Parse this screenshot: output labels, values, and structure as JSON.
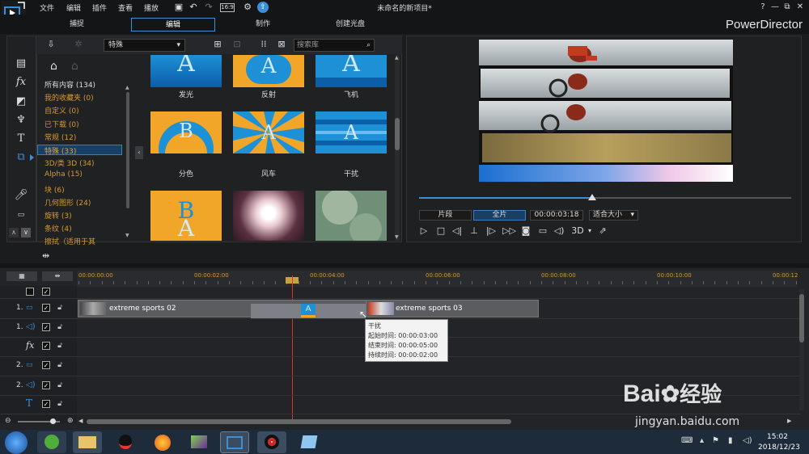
{
  "menu": [
    "文件",
    "编辑",
    "插件",
    "查看",
    "播放"
  ],
  "window_title": "未命名的新项目*",
  "brand": "PowerDirector",
  "window_controls": [
    "?",
    "—",
    "⧉",
    "✕"
  ],
  "modes": [
    "捕捉",
    "编辑",
    "制作",
    "创建光盘"
  ],
  "active_mode": "编辑",
  "library": {
    "category_select": "特殊",
    "search_placeholder": "搜索库",
    "categories": [
      {
        "label": "所有内容 (134)",
        "style": "white"
      },
      {
        "label": "我的收藏夹 (0)",
        "style": "orange"
      },
      {
        "label": "自定义 (0)",
        "style": "orange"
      },
      {
        "label": "已下载 (0)",
        "style": "orange"
      },
      {
        "label": "常规 (12)",
        "style": "orange"
      },
      {
        "label": "特殊 (33)",
        "style": "selected"
      },
      {
        "label": "3D/类 3D (34)",
        "style": "orange"
      },
      {
        "label": "Alpha (15)",
        "style": "orange"
      },
      {
        "label": "块 (6)",
        "style": "orange"
      },
      {
        "label": "几何图形 (24)",
        "style": "orange"
      },
      {
        "label": "旋转 (3)",
        "style": "orange"
      },
      {
        "label": "条纹 (4)",
        "style": "orange"
      },
      {
        "label": "擦拭（适用于其",
        "style": "orange"
      }
    ],
    "thumbnails": [
      {
        "label": "发光",
        "icon": "glow-thumb"
      },
      {
        "label": "反射",
        "icon": "reflect-thumb"
      },
      {
        "label": "飞机",
        "icon": "plane-thumb"
      },
      {
        "label": "分色",
        "icon": "split-color-thumb"
      },
      {
        "label": "风车",
        "icon": "windmill-thumb"
      },
      {
        "label": "干扰",
        "icon": "interference-thumb"
      },
      {
        "label": "",
        "icon": "a-b-thumb"
      },
      {
        "label": "",
        "icon": "light-burst-thumb"
      },
      {
        "label": "",
        "icon": "green-circles-thumb"
      }
    ]
  },
  "preview": {
    "progress": 0.465,
    "buttons": {
      "clip": "片段",
      "full": "全片",
      "timecode": "00:00:03:18",
      "fit": "适合大小"
    },
    "controls": [
      "play-icon",
      "stop-icon",
      "prev-frame-icon",
      "split-icon",
      "next-frame-icon",
      "fast-forward-icon",
      "snapshot-icon",
      "subtitle-icon",
      "volume-icon",
      "3d-icon",
      "undock-icon"
    ],
    "three_d_label": "3D"
  },
  "timeline": {
    "ticks": [
      "00:00:00:00",
      "00:00:02:00",
      "00:00:04:00",
      "00:00:06:00",
      "00:00:08:00",
      "00:00:10:00",
      "00:00:12"
    ],
    "tracks": [
      "1.",
      "1.",
      "",
      "2.",
      "2.",
      ""
    ],
    "clip1": "extreme sports 02",
    "clip2": "extreme sports 03",
    "tooltip": {
      "title": "干扰",
      "start": "起始时间: 00:00:03:00",
      "end": "结束时间: 00:00:05:00",
      "duration": "持续时间:  00:00:02:00"
    }
  },
  "taskbar": {
    "time": "15:02",
    "date": "2018/12/23"
  },
  "watermark": {
    "brand": "Bai",
    "brand2": "经验",
    "url": "jingyan.baidu.com"
  }
}
